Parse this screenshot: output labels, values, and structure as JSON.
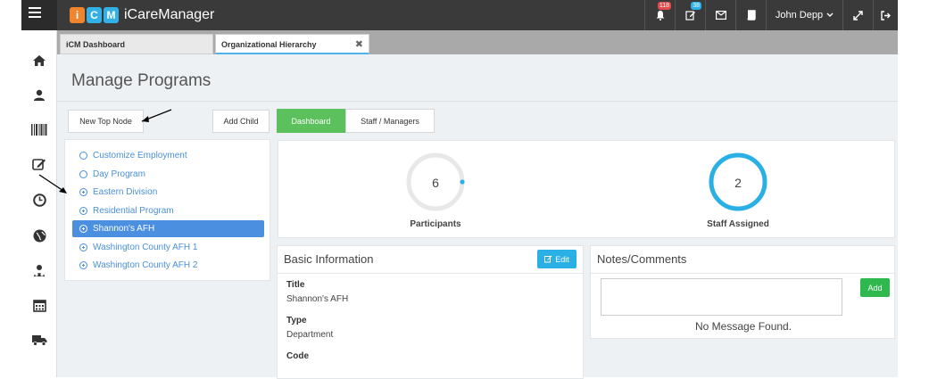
{
  "app": {
    "logo_letters": [
      "i",
      "C",
      "M"
    ],
    "logo_colors": [
      "#f0852d",
      "#33b1e6",
      "#33b1e6"
    ],
    "name": "iCareManager"
  },
  "header": {
    "notification_count": "118",
    "tasks_count": "38",
    "user_name": "John Depp",
    "badge_colors": {
      "notifications": "#e04b4b",
      "tasks": "#2ab0e4"
    }
  },
  "left_nav": [
    {
      "icon": "home-icon"
    },
    {
      "icon": "user-icon"
    },
    {
      "icon": "barcode-icon"
    },
    {
      "icon": "edit-icon"
    },
    {
      "icon": "clock-icon"
    },
    {
      "icon": "globe-icon"
    },
    {
      "icon": "staff-icon"
    },
    {
      "icon": "calendar-icon"
    },
    {
      "icon": "truck-icon"
    }
  ],
  "tabs": [
    {
      "label": "iCM Dashboard"
    },
    {
      "label": "Organizational Hierarchy",
      "close": "✖"
    }
  ],
  "page": {
    "title": "Manage Programs"
  },
  "toolbar": {
    "new_top_node": "New Top Node",
    "add_child": "Add Child",
    "dashboard": "Dashboard",
    "staff_managers": "Staff / Managers"
  },
  "tree": [
    {
      "label": "Customize Employment",
      "type": "leaf"
    },
    {
      "label": "Day Program",
      "type": "leaf"
    },
    {
      "label": "Eastern Division",
      "type": "expandable"
    },
    {
      "label": "Residential Program",
      "type": "expandable"
    },
    {
      "label": "Shannon's AFH",
      "type": "expandable",
      "selected": true
    },
    {
      "label": "Washington County AFH 1",
      "type": "expandable"
    },
    {
      "label": "Washington County AFH 2",
      "type": "expandable"
    }
  ],
  "stats": {
    "participants": {
      "value": "6",
      "label": "Participants"
    },
    "staff_assigned": {
      "value": "2",
      "label": "Staff Assigned"
    }
  },
  "basic_info": {
    "title": "Basic Information",
    "edit_label": "Edit",
    "fields": [
      {
        "label": "Title",
        "value": "Shannon's AFH"
      },
      {
        "label": "Type",
        "value": "Department"
      },
      {
        "label": "Code",
        "value": ""
      }
    ]
  },
  "notes": {
    "title": "Notes/Comments",
    "add_label": "Add",
    "empty_message": "No Message Found."
  }
}
